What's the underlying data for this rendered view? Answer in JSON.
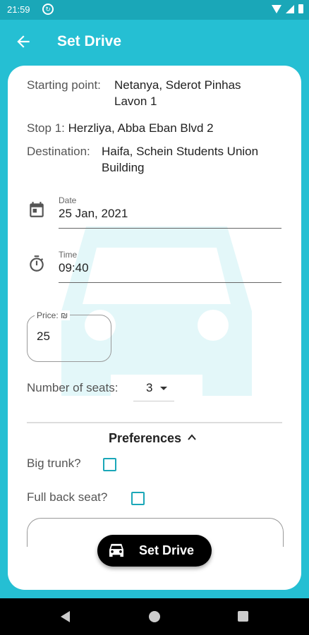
{
  "status_bar": {
    "time": "21:59"
  },
  "app_bar": {
    "title": "Set Drive"
  },
  "route": {
    "start_label": "Starting point:",
    "start_line1": "Netanya, Sderot Pinhas",
    "start_line2": "Lavon 1",
    "stop_label": "Stop 1:",
    "stop_value": "Herzliya, Abba Eban Blvd 2",
    "dest_label": "Destination:",
    "dest_line1": "Haifa, Schein Students Union",
    "dest_line2": "Building"
  },
  "date": {
    "label": "Date",
    "value": "25 Jan, 2021"
  },
  "time": {
    "label": "Time",
    "value": "09:40"
  },
  "price": {
    "label": "Price: ₪",
    "value": "25"
  },
  "seats": {
    "label": "Number of seats:",
    "value": "3"
  },
  "preferences": {
    "title": "Preferences",
    "big_trunk": "Big trunk?",
    "big_trunk_checked": false,
    "full_back_seat": "Full back seat?",
    "full_back_seat_checked": false
  },
  "actions": {
    "set_drive": "Set Drive"
  },
  "colors": {
    "primary": "#25bfd3",
    "status_bar": "#1aa7b8",
    "button": "#000000"
  },
  "icons": {
    "back": "arrow-back-icon",
    "date": "calendar-icon",
    "time": "timer-icon",
    "seats_caret": "caret-down-icon",
    "preferences": "chevron-up-icon",
    "button": "car-icon"
  }
}
